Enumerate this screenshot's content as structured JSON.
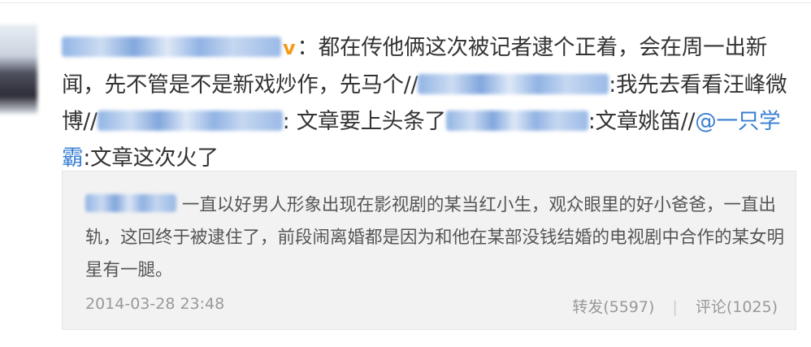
{
  "post": {
    "text_1": "：都在传他俩这次被记者逮个正着，会在周一出新闻，先不管是不是新戏炒作，先马个//",
    "text_2": ":我先去看看汪峰微博//",
    "text_3": ": 文章要上头条了",
    "text_4": ":文章姚笛//",
    "mention": "@一只学霸",
    "text_5": ":文章这次火了"
  },
  "quoted": {
    "text": "一直以好男人形象出现在影视剧的某当红小生，观众眼里的好小爸爸，一直出轨，这回终于被逮住了，前段闹离婚都是因为和他在某部没钱结婚的电视剧中合作的某女明星有一腿。",
    "timestamp": "2014-03-28 23:48",
    "repost_label": "转发(5597)",
    "separator": "|",
    "comment_label": "评论(1025)"
  },
  "icons": {
    "vip_icon": "v",
    "vip_color": "#f39a1b",
    "mention_color": "#3a7fd1"
  }
}
